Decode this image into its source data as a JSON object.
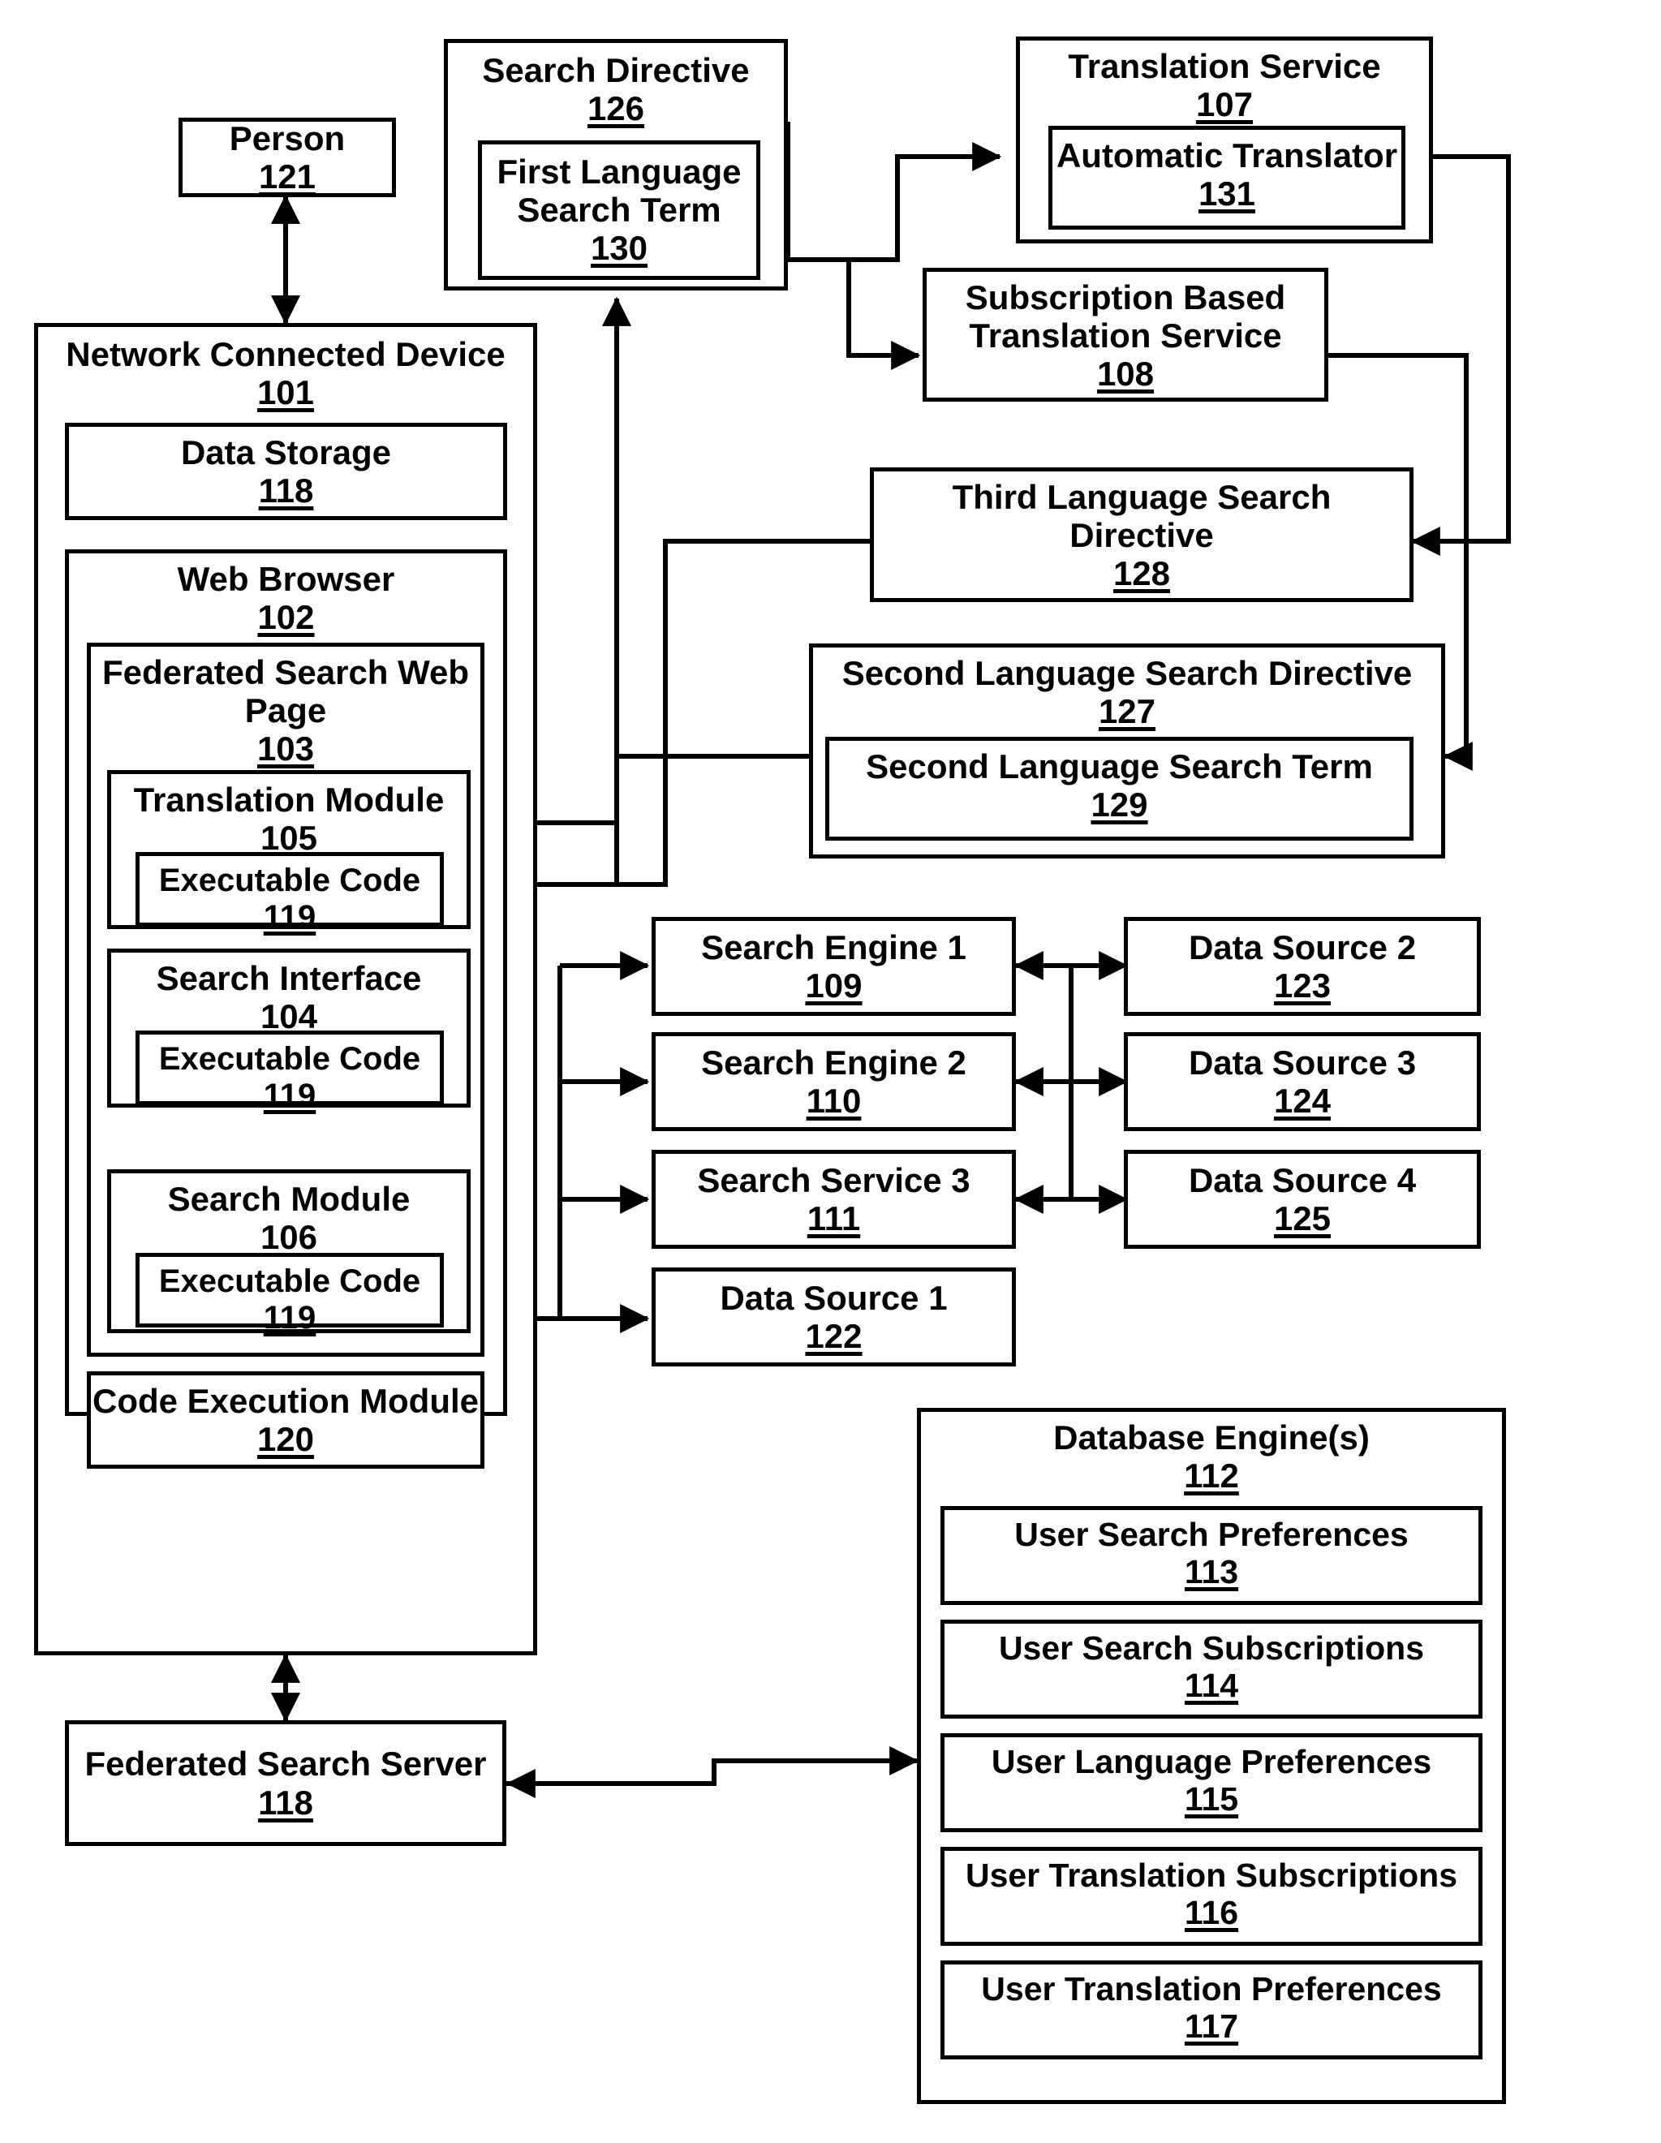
{
  "figure": {
    "type": "patent-block-diagram",
    "background": "#ffffff",
    "line_color": "#000000"
  },
  "nodes": {
    "person": {
      "title": "Person",
      "ref": "121"
    },
    "search_directive": {
      "title": "Search Directive",
      "ref": "126"
    },
    "first_lang_term": {
      "title": "First Language\nSearch Term",
      "ref": "130"
    },
    "translation_service": {
      "title": "Translation Service",
      "ref": "107"
    },
    "automatic_translator": {
      "title": "Automatic Translator",
      "ref": "131"
    },
    "sub_translation_service": {
      "title": "Subscription Based\nTranslation Service",
      "ref": "108"
    },
    "third_lang_directive": {
      "title": "Third Language Search\nDirective",
      "ref": "128"
    },
    "second_lang_directive": {
      "title": "Second Language Search Directive",
      "ref": "127"
    },
    "second_lang_term": {
      "title": "Second Language Search Term",
      "ref": "129"
    },
    "network_device": {
      "title": "Network Connected Device",
      "ref": "101"
    },
    "data_storage": {
      "title": "Data Storage",
      "ref": "118"
    },
    "web_browser": {
      "title": "Web Browser",
      "ref": "102"
    },
    "federated_page": {
      "title": "Federated Search Web\nPage",
      "ref": "103"
    },
    "translation_module": {
      "title": "Translation Module",
      "ref": "105"
    },
    "exec_code_105": {
      "title": "Executable Code",
      "ref": "119"
    },
    "search_interface": {
      "title": "Search Interface",
      "ref": "104"
    },
    "exec_code_104": {
      "title": "Executable Code",
      "ref": "119"
    },
    "search_module": {
      "title": "Search Module",
      "ref": "106"
    },
    "exec_code_106": {
      "title": "Executable Code",
      "ref": "119"
    },
    "code_exec_module": {
      "title": "Code Execution Module",
      "ref": "120"
    },
    "federated_server": {
      "title": "Federated Search Server",
      "ref": "118"
    },
    "search_engine_1": {
      "title": "Search Engine 1",
      "ref": "109"
    },
    "search_engine_2": {
      "title": "Search Engine 2",
      "ref": "110"
    },
    "search_service_3": {
      "title": "Search Service 3",
      "ref": "111"
    },
    "data_source_1": {
      "title": "Data Source 1",
      "ref": "122"
    },
    "data_source_2": {
      "title": "Data Source 2",
      "ref": "123"
    },
    "data_source_3": {
      "title": "Data Source 3",
      "ref": "124"
    },
    "data_source_4": {
      "title": "Data Source 4",
      "ref": "125"
    },
    "database_engines": {
      "title": "Database Engine(s)",
      "ref": "112"
    },
    "user_search_prefs": {
      "title": "User Search Preferences",
      "ref": "113"
    },
    "user_search_subs": {
      "title": "User Search Subscriptions",
      "ref": "114"
    },
    "user_lang_prefs": {
      "title": "User Language Preferences",
      "ref": "115"
    },
    "user_trans_subs": {
      "title": "User Translation Subscriptions",
      "ref": "116"
    },
    "user_trans_prefs": {
      "title": "User Translation Preferences",
      "ref": "117"
    }
  }
}
